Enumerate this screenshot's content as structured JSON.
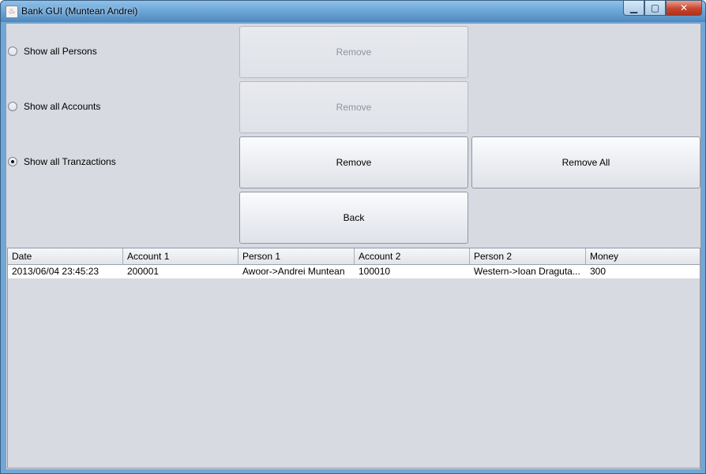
{
  "window": {
    "title": "Bank GUI (Muntean Andrei)",
    "icon": "java-cup-icon",
    "controls": {
      "minimize": "▁",
      "maximize": "▢",
      "close": "✕"
    }
  },
  "radios": [
    {
      "label": "Show all Persons",
      "checked": false
    },
    {
      "label": "Show all Accounts",
      "checked": false
    },
    {
      "label": "Show all Tranzactions",
      "checked": true
    }
  ],
  "buttons": {
    "remove_persons": "Remove",
    "remove_accounts": "Remove",
    "remove_tranzactions": "Remove",
    "remove_all": "Remove All",
    "back": "Back"
  },
  "table": {
    "columns": [
      "Date",
      "Account 1",
      "Person 1",
      "Account 2",
      "Person 2",
      "Money"
    ],
    "rows": [
      [
        "2013/06/04 23:45:23",
        "200001",
        "Awoor->Andrei Muntean",
        "100010",
        "Western->Ioan Draguta...",
        "300"
      ]
    ]
  }
}
